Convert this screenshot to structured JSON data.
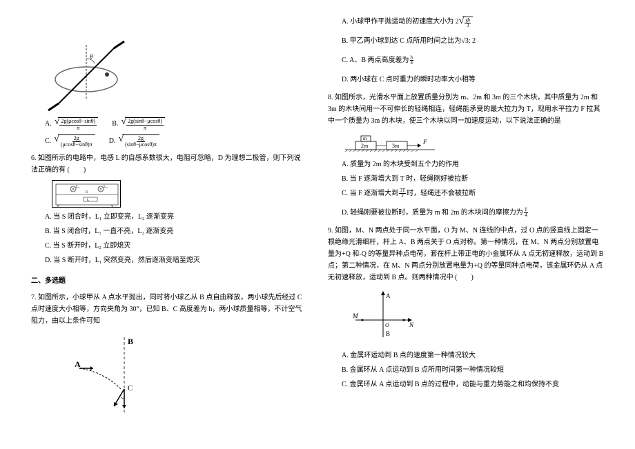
{
  "left": {
    "q5_options": {
      "A": {
        "label": "A.",
        "num": "2g(μcosθ−sinθ)",
        "den": "π"
      },
      "B": {
        "label": "B.",
        "num": "2g(sinθ−μcosθ)",
        "den": "π"
      },
      "C": {
        "label": "C.",
        "num": "2g",
        "den": "(μcosθ−sinθ)π"
      },
      "D": {
        "label": "D.",
        "num": "2g",
        "den": "(sinθ−μcosθ)π"
      }
    },
    "q6_stem": "6. 如图所示的电路中，电感 L 的自感系数很大，电阻可忽略，D 为理想二极管，则下列说法正确的有 (　　)",
    "q6_A": "A. 当 S 闭合时，L₁ 立即变亮，L₂ 逐渐变亮",
    "q6_B": "B. 当 S 闭合时，L₁ 一直不亮，L₂ 逐渐变亮",
    "q6_C": "C. 当 S 断开时，L₂ 立即熄灭",
    "q6_D": "D. 当 S 断开时，L₁ 突然变亮，然后逐渐变暗至熄灭",
    "section2": "二、多选题",
    "q7_stem": "7. 如图所示，小球甲从 A 点水平抛出，同时将小球乙从 B 点自由释放，两小球先后经过 C 点时速度大小相等，方向夹角为 30°，已知 B、C 高度差为 h，两小球质量相等，不计空气阻力，由以上条件可知",
    "labels": {
      "A": "A",
      "B": "B",
      "C": "C"
    }
  },
  "right": {
    "q7_A": "A. 小球甲作平抛运动的初速度大小为",
    "q7_A_num": "gh",
    "q7_A_den": "3",
    "q7_A_prefix": "2",
    "q7_B": "B. 甲乙两小球到达 C 点所用时间之比为√3: 2",
    "q7_C": "C. A、B 两点高度差为",
    "q7_C_num": "h",
    "q7_C_den": "4",
    "q7_D": "D. 两小球在 C 点时重力的瞬时功率大小相等",
    "q8_stem": "8. 如图所示，光滑水平面上放置质量分别为 m、2m 和 3m 的三个木块，其中质量为 2m 和 3m 的木块间用一不可伸长的轻绳相连，轻绳能承受的最大拉力为 T，现用水平拉力 F 拉其中一个质量为 3m 的木块，使三个木块以同一加速度运动，以下说法正确的是",
    "block_m": "m",
    "block_2m": "2m",
    "block_3m": "3m",
    "force_F": "F",
    "q8_A": "A. 质量为 2m 的木块受到五个力的作用",
    "q8_B": "B. 当 F 逐渐增大到 T 时，轻绳刚好被拉断",
    "q8_C": "C. 当 F 逐渐增大到",
    "q8_C_num": "3T",
    "q8_C_den": "2",
    "q8_C_tail": "时，轻绳还不会被拉断",
    "q8_D": "D. 轻绳刚要被拉断时，质量为 m 和 2m 的木块间的摩擦力为",
    "q8_D_num": "T",
    "q8_D_den": "4",
    "q9_stem": "9. 如图，M、N 两点处于同一水平面，O 为 M、N 连线的中点，过 O 点的竖直线上固定一根绝缘光滑细杆，杆上 A、B 两点关于 O 点对称。第一种情况，在 M、N 两点分别放置电量为+Q 和-Q 的等量异种点电荷，套在杆上带正电的小金属环从 A 点无初速释放，运动到 B 点；第二种情况，在 M、N 两点分别放置电量为+Q 的等量同种点电荷，该金属环仍从 A 点无初速释放，运动到 B 点。则两种情况中 (　　)",
    "axis": {
      "A": "A",
      "B": "B",
      "M": "M",
      "N": "N",
      "O": "O"
    },
    "q9_A": "A. 金属环运动到 B 点的速度第一种情况较大",
    "q9_B": "B. 金属环从 A 点运动到 B 点所用时间第一种情况较短",
    "q9_C": "C. 金属环从 A 点运动到 B 点的过程中，动能与重力势能之和均保持不变"
  }
}
